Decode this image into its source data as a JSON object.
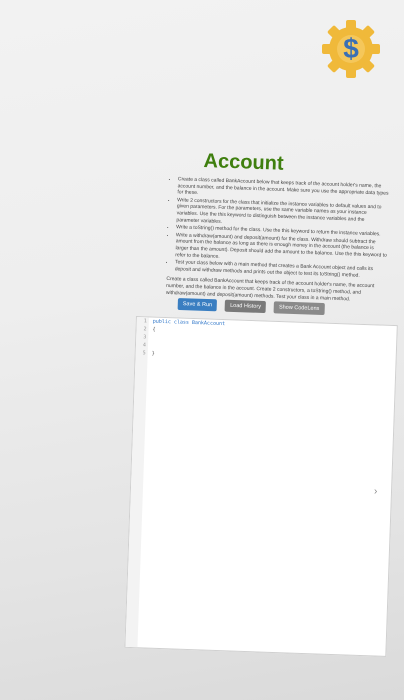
{
  "page": {
    "title": "Account",
    "instructions": {
      "intro": "Create a class called BankAccount below that keeps track of the account holder's name, the account number, and the balance in the account. Make sure you use the appropriate data types for these.",
      "bullets": [
        "Write 2 constructors for the class that initialize the instance variables to default values and to given parameters. For the parameters, use the same variable names as your instance variables. Use the this keyword to distinguish between the instance variables and the parameter variables.",
        "Write a toString() method for the class. Use the this keyword to return the instance variables.",
        "Write a withdraw(amount) and deposit(amount) for the class. Withdraw should subtract the amount from the balance as long as there is enough money in the account (the balance is larger than the amount). Deposit should add the amount to the balance. Use the this keyword to refer to the balance.",
        "Test your class below with a main method that creates a Bank Account object and calls its deposit and withdraw methods and prints out the object to test its toString() method."
      ],
      "summary": "Create a class called BankAccount that keeps track of the account holder's name, the account number, and the balance in the account. Create 2 constructors, a toString() method, and withdraw(amount) and deposit(amount) methods. Test your class in a main method."
    },
    "buttons": {
      "save_run": "Save & Run",
      "load_history": "Load History",
      "show_codelens": "Show CodeLens"
    },
    "editor": {
      "line_numbers": [
        "1",
        "2",
        "3",
        "4",
        "5"
      ],
      "lines": [
        "public class BankAccount",
        "{",
        "",
        "",
        "}"
      ]
    }
  }
}
